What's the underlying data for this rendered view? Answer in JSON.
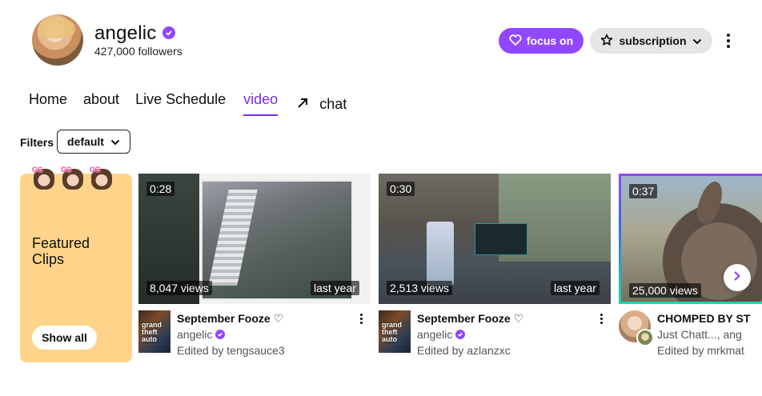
{
  "channel": {
    "name": "angelic",
    "followers": "427,000 followers",
    "follow_label": "focus on",
    "subscribe_label": "subscription"
  },
  "tabs": [
    {
      "label": "Home"
    },
    {
      "label": "about"
    },
    {
      "label": "Live Schedule"
    },
    {
      "label": "video"
    },
    {
      "label": "chat"
    }
  ],
  "filters": {
    "label": "Filters",
    "selected": "default"
  },
  "featured": {
    "title": "Featured Clips",
    "emote_text": "GG",
    "show_all_label": "Show all"
  },
  "clips": [
    {
      "duration": "0:28",
      "views": "8,047 views",
      "age": "last year",
      "title": "September Fooze ♡",
      "channel": "angelic",
      "edited": "Edited by tengsauce3",
      "game_art_text": "grand theft auto"
    },
    {
      "duration": "0:30",
      "views": "2,513 views",
      "age": "last year",
      "title": "September Fooze ♡",
      "channel": "angelic",
      "edited": "Edited by azlanzxc",
      "game_art_text": "grand theft auto"
    },
    {
      "duration": "0:37",
      "views": "25,000 views",
      "title": "CHOMPED BY ST",
      "channel": "Just Chatt..., ang",
      "edited": "Edited by mrkmat"
    }
  ],
  "colors": {
    "accent": "#9147ff",
    "accent_text": "#772ce8",
    "featured_bg": "#ffd48a"
  }
}
